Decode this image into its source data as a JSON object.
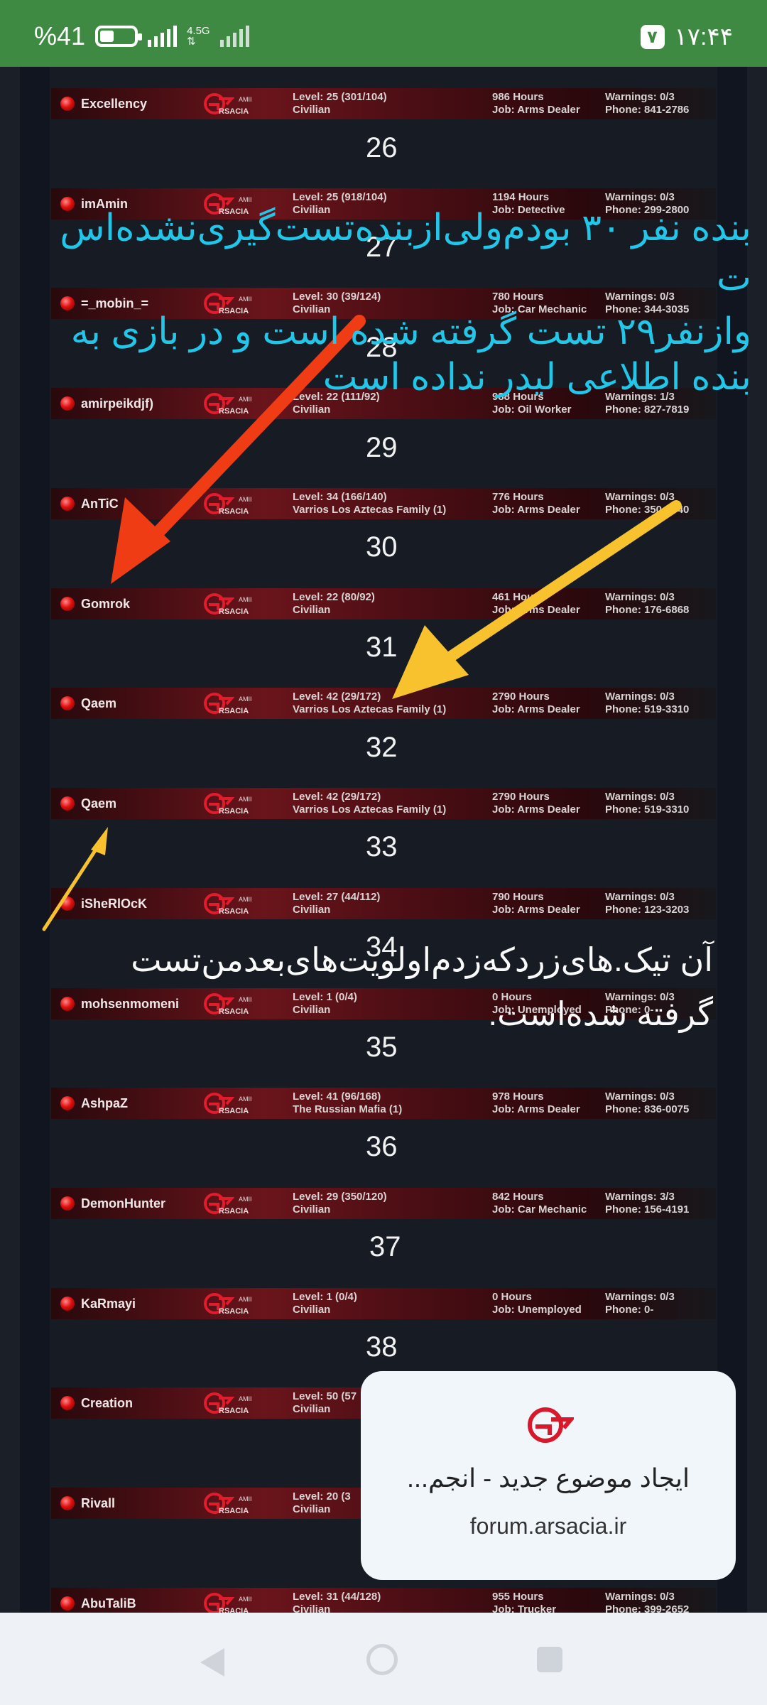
{
  "status_bar": {
    "battery_text": "%41",
    "battery_level": 0.41,
    "network": "4.5G",
    "time": "۱۷:۴۴",
    "notification_badge": "۷"
  },
  "rows": [
    {
      "name": "Excellency",
      "level": "Level: 25 (301/104)",
      "faction": "Civilian",
      "hours": "986 Hours",
      "job": "Job: Arms Dealer",
      "warnings": "Warnings: 0/3",
      "phone": "Phone: 841-2786"
    },
    {
      "name": "imAmin",
      "level": "Level: 25 (918/104)",
      "faction": "Civilian",
      "hours": "1194 Hours",
      "job": "Job: Detective",
      "warnings": "Warnings: 0/3",
      "phone": "Phone: 299-2800"
    },
    {
      "name": "=_mobin_=",
      "level": "Level: 30 (39/124)",
      "faction": "Civilian",
      "hours": "780 Hours",
      "job": "Job: Car Mechanic",
      "warnings": "Warnings: 0/3",
      "phone": "Phone: 344-3035"
    },
    {
      "name": "amirpeikdjf)",
      "level": "Level: 22 (111/92)",
      "faction": "Civilian",
      "hours": "988 Hours",
      "job": "Job: Oil Worker",
      "warnings": "Warnings: 1/3",
      "phone": "Phone: 827-7819"
    },
    {
      "name": "AnTiC",
      "level": "Level: 34 (166/140)",
      "faction": "Varrios Los Aztecas Family (1)",
      "hours": "776 Hours",
      "job": "Job: Arms Dealer",
      "warnings": "Warnings: 0/3",
      "phone": "Phone: 350-6040"
    },
    {
      "name": "Gomrok",
      "level": "Level: 22 (80/92)",
      "faction": "Civilian",
      "hours": "461 Hours",
      "job": "Job: Arms Dealer",
      "warnings": "Warnings: 0/3",
      "phone": "Phone: 176-6868"
    },
    {
      "name": "Qaem",
      "level": "Level: 42 (29/172)",
      "faction": "Varrios Los Aztecas Family (1)",
      "hours": "2790 Hours",
      "job": "Job: Arms Dealer",
      "warnings": "Warnings: 0/3",
      "phone": "Phone: 519-3310"
    },
    {
      "name": "Qaem",
      "level": "Level: 42 (29/172)",
      "faction": "Varrios Los Aztecas Family (1)",
      "hours": "2790 Hours",
      "job": "Job: Arms Dealer",
      "warnings": "Warnings: 0/3",
      "phone": "Phone: 519-3310"
    },
    {
      "name": "iSheRlOcK",
      "level": "Level: 27 (44/112)",
      "faction": "Civilian",
      "hours": "790 Hours",
      "job": "Job: Arms Dealer",
      "warnings": "Warnings: 0/3",
      "phone": "Phone: 123-3203"
    },
    {
      "name": "mohsenmomeni",
      "level": "Level: 1 (0/4)",
      "faction": "Civilian",
      "hours": "0 Hours",
      "job": "Job: Unemployed",
      "warnings": "Warnings: 0/3",
      "phone": "Phone: 0-"
    },
    {
      "name": "AshpaZ",
      "level": "Level: 41 (96/168)",
      "faction": "The Russian Mafia (1)",
      "hours": "978 Hours",
      "job": "Job: Arms Dealer",
      "warnings": "Warnings: 0/3",
      "phone": "Phone: 836-0075"
    },
    {
      "name": "DemonHunter",
      "level": "Level: 29 (350/120)",
      "faction": "Civilian",
      "hours": "842 Hours",
      "job": "Job: Car Mechanic",
      "warnings": "Warnings: 3/3",
      "phone": "Phone: 156-4191"
    },
    {
      "name": "KaRmayi",
      "level": "Level: 1 (0/4)",
      "faction": "Civilian",
      "hours": "0 Hours",
      "job": "Job: Unemployed",
      "warnings": "Warnings: 0/3",
      "phone": "Phone: 0-"
    },
    {
      "name": "Creation",
      "level": "Level: 50 (57",
      "faction": "Civilian",
      "hours": "",
      "job": "",
      "warnings": "",
      "phone": ""
    },
    {
      "name": "Rivall",
      "level": "Level: 20 (3",
      "faction": "Civilian",
      "hours": "",
      "job": "",
      "warnings": "",
      "phone": ""
    },
    {
      "name": "AbuTaliB",
      "level": "Level: 31 (44/128)",
      "faction": "Civilian",
      "hours": "955 Hours",
      "job": "Job: Trucker",
      "warnings": "Warnings: 0/3",
      "phone": "Phone: 399-2652"
    }
  ],
  "numbers": [
    "26",
    "27",
    "28",
    "29",
    "30",
    "31",
    "32",
    "33",
    "34",
    "35",
    "36",
    "37",
    "38"
  ],
  "annotations": {
    "cyan_line1": "بنده نفر ۳۰ بودم‌ولی‌ازبنده‌تست‌گیری‌نشده‌اس",
    "cyan_line2": "ت",
    "cyan_line3": "وازنفر۲۹ تست گرفته شده است و در بازی به",
    "cyan_line4": "بنده اطلاعی لیدر  نداده است",
    "white_line1": "آن تیک.های‌زردکه‌زدم‌اولویت‌های‌بعدمن‌تست",
    "white_line2": "گرفته شده‌است."
  },
  "card": {
    "title": "ایجاد موضوع جدید - انجم...",
    "url": "forum.arsacia.ir"
  },
  "colors": {
    "status_bar": "#3f8a43",
    "arrow_red": "#f03c14",
    "arrow_yellow": "#f8c22e",
    "annotation_cyan": "#22c6e8"
  }
}
